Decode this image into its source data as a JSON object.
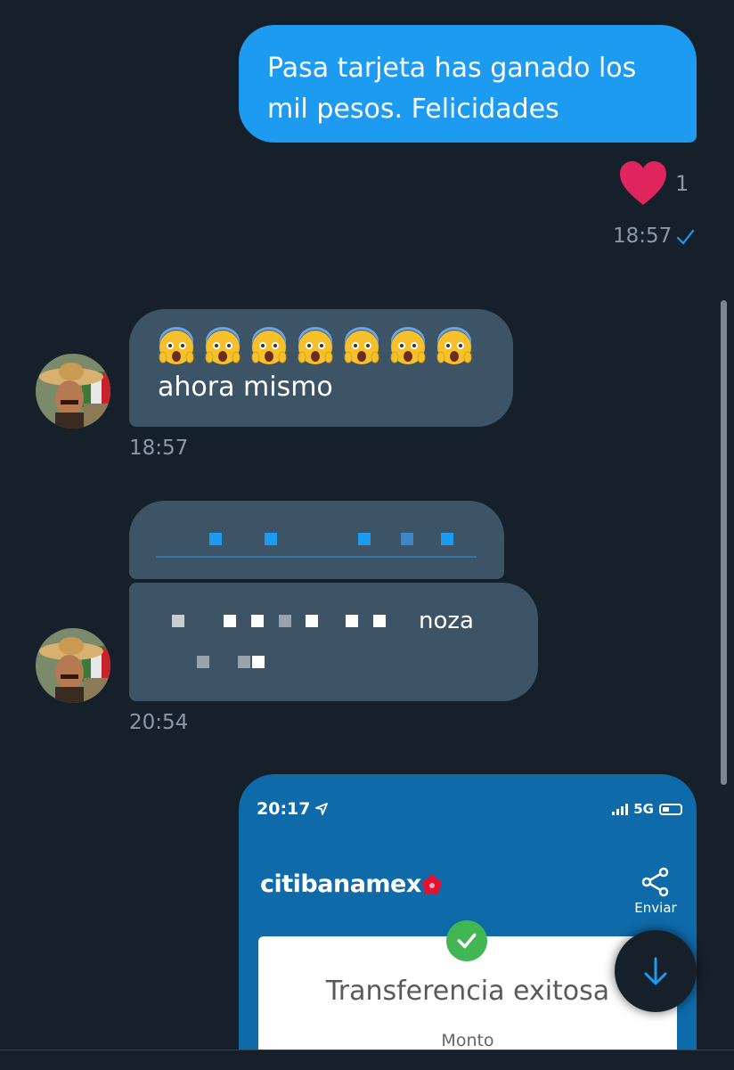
{
  "messages": {
    "outgoing_1": {
      "text": "Pasa tarjeta has ganado los mil pesos. Felicidades",
      "time": "18:57",
      "reaction": "heart",
      "reaction_count": "1"
    },
    "incoming_1": {
      "emoji": [
        "scream",
        "scream",
        "scream",
        "scream",
        "scream",
        "scream",
        "scream"
      ],
      "text": "ahora mismo",
      "time": "18:57"
    },
    "incoming_2": {
      "visible_fragment": "noza",
      "time": "20:54"
    }
  },
  "image_message": {
    "status_time": "20:17",
    "network": "5G",
    "bank_logo_main": "citibanamex",
    "share_label": "Enviar",
    "card_title": "Transferencia exitosa",
    "card_label": "Monto"
  },
  "colors": {
    "background": "#15202b",
    "outgoing_bubble": "#1d9bf0",
    "incoming_bubble": "#3d5466",
    "heart": "#f91880",
    "bank_blue": "#0e6aa8"
  },
  "icons": {
    "reaction": "heart-icon",
    "read_receipt": "check-icon",
    "scroll_down": "arrow-down-icon",
    "share": "share-icon"
  }
}
